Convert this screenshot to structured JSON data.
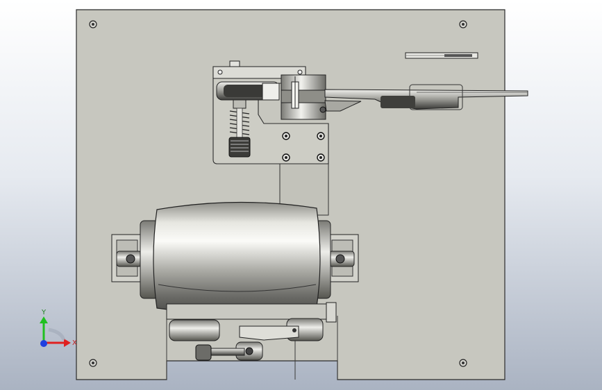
{
  "viewport": {
    "background": "cad-viewport-gradient"
  },
  "colors": {
    "plate": "#c7c7bf",
    "plate_edge": "#2b2b2b",
    "metal_light": "#f2f2ee",
    "metal_mid": "#b9b9b3",
    "metal_dark": "#5c5c58",
    "axis_x": "#e02020",
    "axis_y": "#20c020",
    "axis_z": "#2040e0"
  },
  "triad": {
    "x_label": "X",
    "y_label": "Y",
    "icons": [
      "x-axis-arrow-icon",
      "y-axis-arrow-icon",
      "z-axis-dot-icon"
    ]
  },
  "model": {
    "parts": [
      "base-plate",
      "mounting-screws",
      "motor-drum",
      "motor-end-caps",
      "bearing-brackets",
      "pulley-bracket",
      "spring-assembly",
      "clamp-block",
      "tension-arm",
      "tab-bracket",
      "crank-linkage"
    ]
  }
}
